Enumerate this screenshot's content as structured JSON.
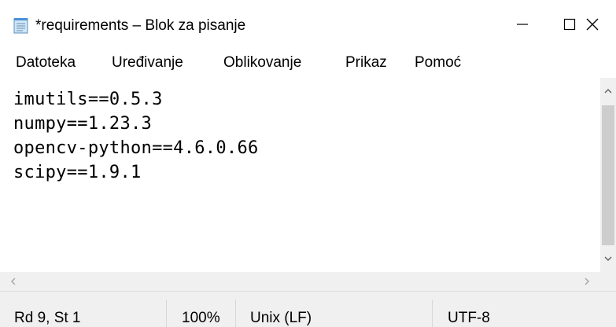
{
  "window": {
    "title": "*requirements – Blok za pisanje",
    "icon": "notepad-icon",
    "minimize_glyph": "—",
    "maximize_glyph": "☐",
    "close_glyph": "✕"
  },
  "menu": {
    "items": [
      {
        "label": "Datoteka"
      },
      {
        "label": "Uređivanje"
      },
      {
        "label": "Oblikovanje"
      },
      {
        "label": "Prikaz"
      },
      {
        "label": "Pomoć"
      }
    ]
  },
  "editor": {
    "lines": [
      "imutils==0.5.3",
      "numpy==1.23.3",
      "opencv-python==4.6.0.66",
      "scipy==1.9.1"
    ]
  },
  "status": {
    "position": "Rd 9, St 1",
    "zoom": "100%",
    "line_endings": "Unix (LF)",
    "encoding": "UTF-8"
  },
  "colors": {
    "chrome": "#f0f0f0",
    "scroll_thumb": "#cdcdcd",
    "arrow": "#a3a3a3"
  }
}
